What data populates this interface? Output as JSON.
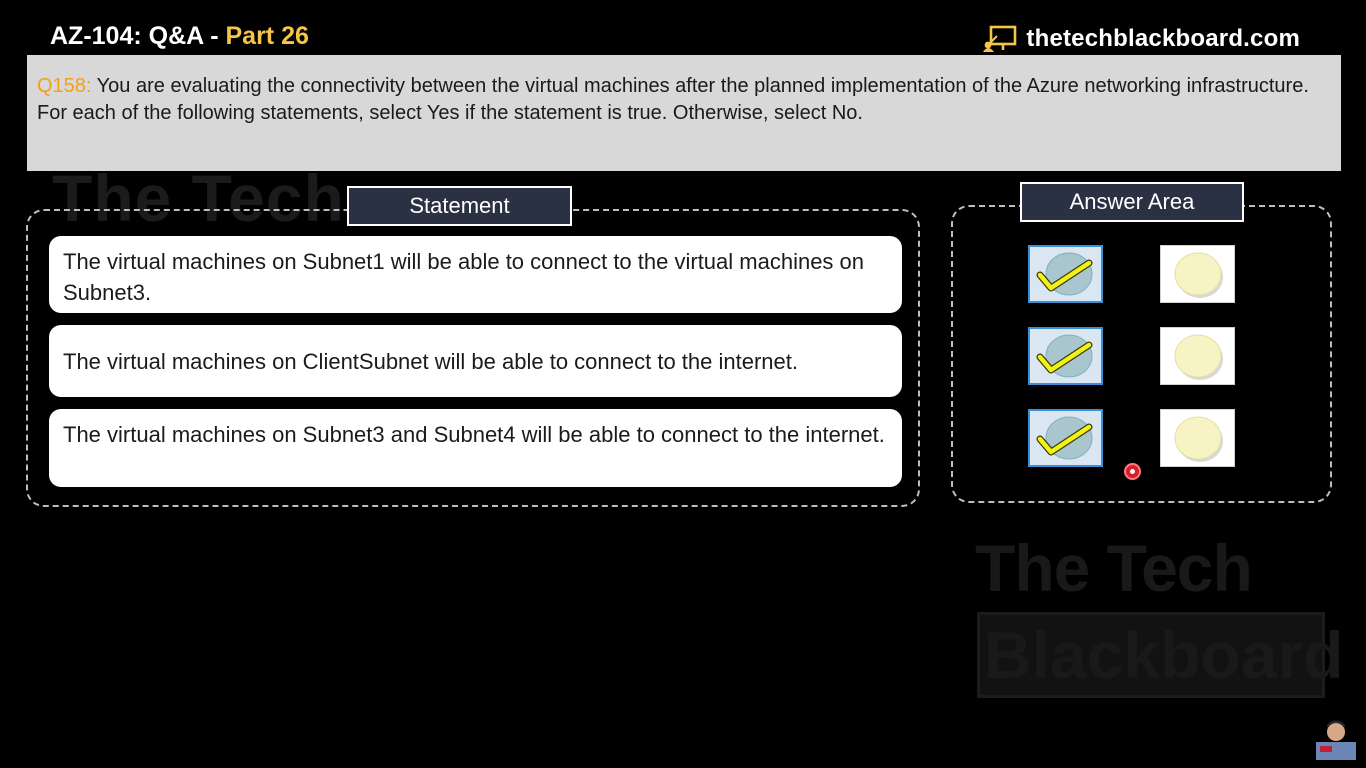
{
  "header": {
    "title_main": "AZ-104: Q&A",
    "title_sep": " - ",
    "title_part": "Part 26",
    "site": "thetechblackboard.com"
  },
  "question": {
    "id": "Q158:",
    "text": " You are evaluating the connectivity between the virtual machines after the planned implementation of the Azure networking infrastructure.",
    "instruction": "For each of the following statements, select Yes if the statement is true. Otherwise, select No."
  },
  "statement_panel": {
    "header": "Statement",
    "statements": [
      "The virtual machines on Subnet1 will be able to connect to the virtual machines on Subnet3.",
      "The virtual machines on ClientSubnet will be able to connect to the internet.",
      "The virtual machines on Subnet3 and Subnet4 will be able to connect to the internet."
    ]
  },
  "answer_panel": {
    "header": "Answer Area",
    "selections": [
      "yes",
      "yes",
      "yes"
    ]
  },
  "watermark": {
    "line1": "The Tech",
    "line2": "Blackboard"
  },
  "colors": {
    "accent_yellow": "#f6c44a",
    "question_id": "#f2a11a",
    "header_bg": "#2a3142",
    "question_bg": "#d8d8d8",
    "check": "#f2f21a",
    "radio_fill": "#f7f3c4"
  },
  "icons": {
    "brand": "board-logo-icon",
    "yes_option": "checkmark-icon",
    "no_option": "radio-circle-icon"
  }
}
